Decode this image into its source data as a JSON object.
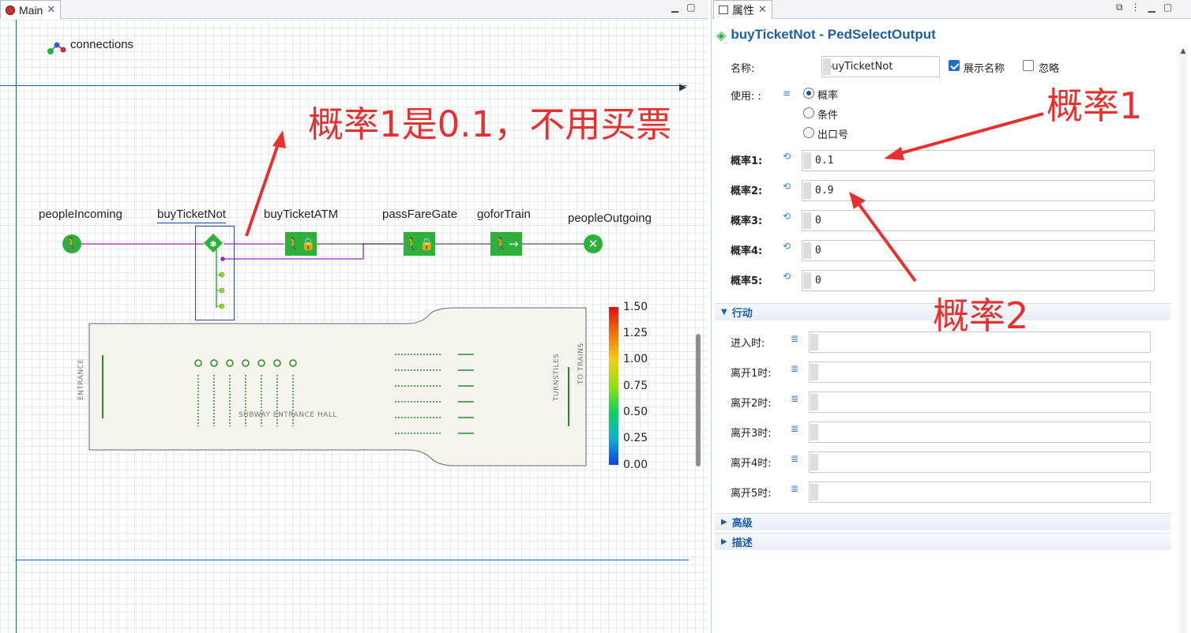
{
  "main_tab": {
    "label": "Main"
  },
  "canvas": {
    "connections_label": "connections",
    "nodes": [
      {
        "label": "peopleIncoming"
      },
      {
        "label": "buyTicketNot"
      },
      {
        "label": "buyTicketATM"
      },
      {
        "label": "passFareGate"
      },
      {
        "label": "goforTrain"
      },
      {
        "label": "peopleOutgoing"
      }
    ],
    "hall": {
      "title": "SUBWAY ENTRANCE HALL",
      "entrance": "ENTRANCE",
      "turnstiles": "TURNSTILES",
      "to_trains": "TO TRAINS"
    },
    "scale": {
      "ticks": [
        "1.50",
        "1.25",
        "1.00",
        "0.75",
        "0.50",
        "0.25",
        "0.00"
      ]
    }
  },
  "annotations": {
    "left_note": "概率1是0.1，不用买票",
    "prob1": "概率1",
    "prob2": "概率2",
    "color": "#e8312f"
  },
  "properties": {
    "tab_label": "属性",
    "title": "buyTicketNot - PedSelectOutput",
    "name_label": "名称:",
    "name_value": "buyTicketNot",
    "show_name_label": "展示名称",
    "show_name_checked": true,
    "ignore_label": "忽略",
    "ignore_checked": false,
    "use_label": "使用: :",
    "use_options": [
      {
        "label": "概率",
        "selected": true
      },
      {
        "label": "条件",
        "selected": false
      },
      {
        "label": "出口号",
        "selected": false
      }
    ],
    "probabilities": [
      {
        "label": "概率1:",
        "value": "0.1"
      },
      {
        "label": "概率2:",
        "value": "0.9"
      },
      {
        "label": "概率3:",
        "value": "0"
      },
      {
        "label": "概率4:",
        "value": "0"
      },
      {
        "label": "概率5:",
        "value": "0"
      }
    ],
    "actions_section": "行动",
    "actions": [
      {
        "label": "进入时:",
        "value": ""
      },
      {
        "label": "离开1时:",
        "value": ""
      },
      {
        "label": "离开2时:",
        "value": ""
      },
      {
        "label": "离开3时:",
        "value": ""
      },
      {
        "label": "离开4时:",
        "value": ""
      },
      {
        "label": "离开5时:",
        "value": ""
      }
    ],
    "advanced_section": "高级",
    "description_section": "描述"
  },
  "colors": {
    "accent": "#1b5fa8",
    "node_green": "#2db13a",
    "link_purple": "#a020c0"
  }
}
